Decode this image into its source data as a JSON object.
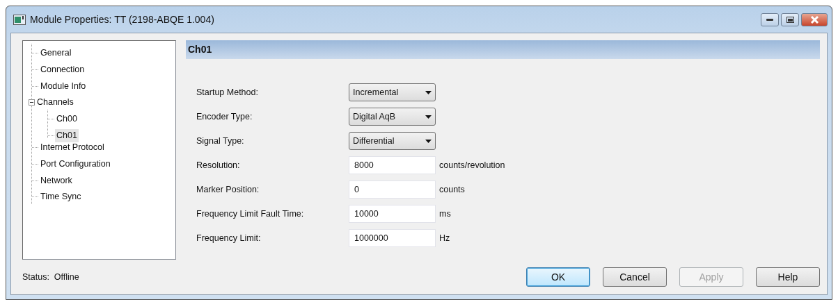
{
  "window": {
    "title": "Module Properties: TT (2198-ABQE 1.004)"
  },
  "tree": [
    {
      "label": "General",
      "selected": false
    },
    {
      "label": "Connection",
      "selected": false
    },
    {
      "label": "Module Info",
      "selected": false
    },
    {
      "label": "Channels",
      "selected": false,
      "expanded": true,
      "children": [
        {
          "label": "Ch00",
          "selected": false
        },
        {
          "label": "Ch01",
          "selected": true
        }
      ]
    },
    {
      "label": "Internet Protocol",
      "selected": false
    },
    {
      "label": "Port Configuration",
      "selected": false
    },
    {
      "label": "Network",
      "selected": false
    },
    {
      "label": "Time Sync",
      "selected": false
    }
  ],
  "section_title": "Ch01",
  "fields": [
    {
      "kind": "dropdown",
      "label": "Startup Method:",
      "value": "Incremental"
    },
    {
      "kind": "dropdown",
      "label": "Encoder Type:",
      "value": "Digital AqB"
    },
    {
      "kind": "dropdown",
      "label": "Signal Type:",
      "value": "Differential"
    },
    {
      "kind": "text",
      "label": "Resolution:",
      "value": "8000",
      "unit": "counts/revolution"
    },
    {
      "kind": "text",
      "label": "Marker Position:",
      "value": "0",
      "unit": "counts"
    },
    {
      "kind": "text",
      "label": "Frequency Limit Fault Time:",
      "value": "10000",
      "unit": "ms"
    },
    {
      "kind": "text",
      "label": "Frequency Limit:",
      "value": "1000000",
      "unit": "Hz"
    }
  ],
  "status": "Status:  Offline",
  "buttons": [
    {
      "label": "OK",
      "default": true,
      "disabled": false
    },
    {
      "label": "Cancel",
      "default": false,
      "disabled": false
    },
    {
      "label": "Apply",
      "default": false,
      "disabled": true
    },
    {
      "label": "Help",
      "default": false,
      "disabled": false
    }
  ]
}
